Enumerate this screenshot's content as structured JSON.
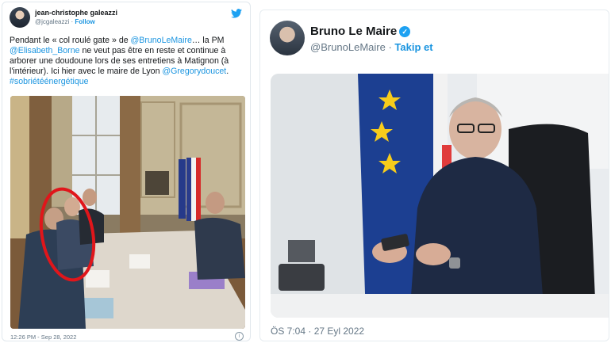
{
  "left_tweet": {
    "author_name": "jean-christophe galeazzi",
    "handle": "@jcgaleazzi",
    "separator": " · ",
    "follow_label": "Follow",
    "text": {
      "p1": "Pendant le « col roulé gate » de ",
      "m1": "@BrunoLeMaire",
      "p2": "… la PM ",
      "m2": "@Elisabeth_Borne",
      "p3": " ne veut pas être en reste et continue à arborer une doudoune lors de ses entretiens à Matignon (à l'intérieur). Ici hier avec le maire de Lyon ",
      "m3": "@Gregorydoucet",
      "p4": ". ",
      "h1": "#sobriétéénergétique"
    },
    "timestamp": "12:26 PM - Sep 28, 2022",
    "info_glyph": "i",
    "icons": [
      "twitter-bird-icon",
      "info-icon"
    ]
  },
  "right_tweet": {
    "author_name": "Bruno Le Maire",
    "verified_glyph": "✓",
    "handle": "@BrunoLeMaire",
    "separator": " · ",
    "follow_label": "Takip et",
    "timestamp": "ÖS 7:04 · 27 Eyl 2022",
    "icons": [
      "verified-badge-icon"
    ]
  },
  "colors": {
    "link": "#1b95e0",
    "muted": "#657786",
    "annotation_circle": "#e0161b"
  }
}
